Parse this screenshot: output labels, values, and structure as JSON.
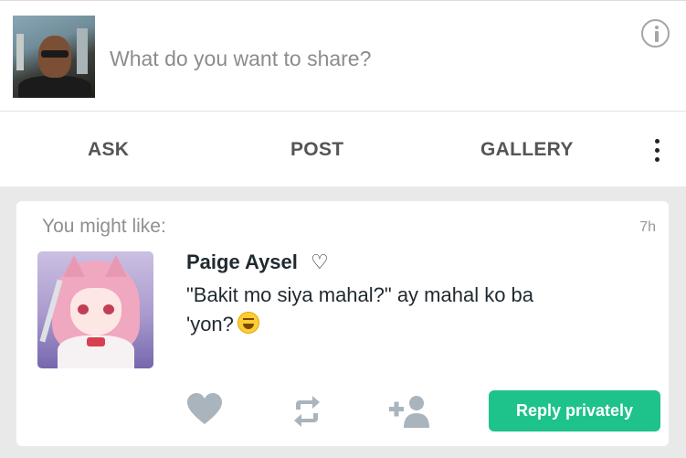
{
  "composer": {
    "placeholder": "What do you want to share?"
  },
  "actions": {
    "ask": "ASK",
    "post": "POST",
    "gallery": "GALLERY"
  },
  "card": {
    "header": "You might like:",
    "time": "7h",
    "author": {
      "name": "Paige Aysel",
      "symbol": "♡"
    },
    "message": "\"Bakit mo siya mahal?\" ay mahal ko ba 'yon?",
    "reply_label": "Reply privately"
  },
  "icons": {
    "info": "info-icon",
    "more": "more-vertical-icon",
    "like": "heart-icon",
    "repost": "repost-icon",
    "follow": "add-person-icon"
  },
  "colors": {
    "accent": "#1ec28b",
    "icon_gray": "#a9b4bd",
    "background": "#e9e9e9"
  }
}
